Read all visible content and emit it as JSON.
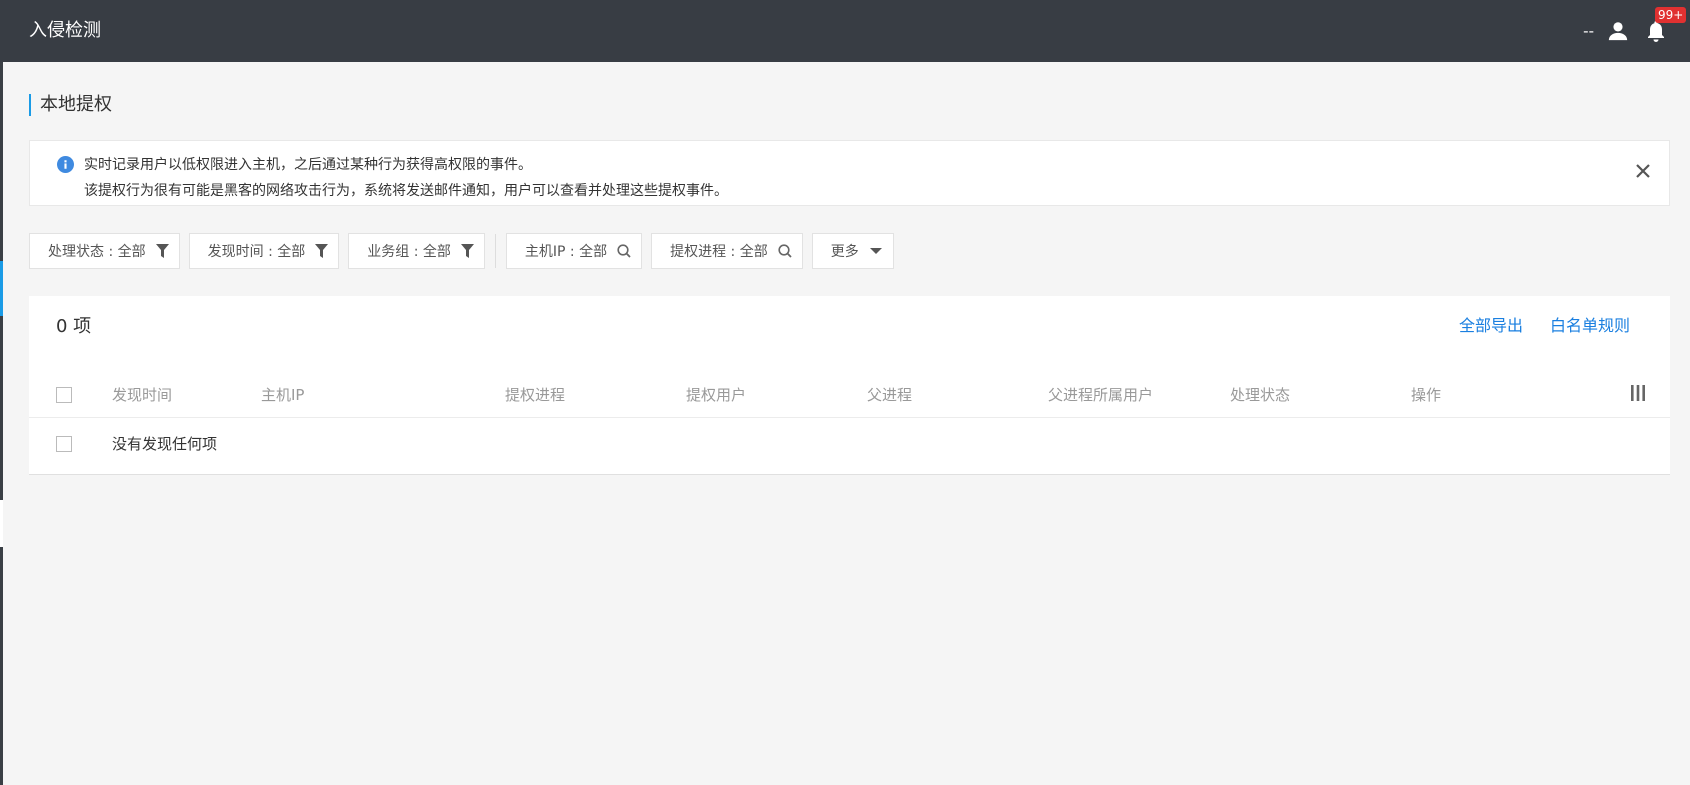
{
  "header": {
    "title": "入侵检测",
    "user_name": "--",
    "notification_badge": "99+"
  },
  "page": {
    "title": "本地提权"
  },
  "banner": {
    "line1": "实时记录用户以低权限进入主机，之后通过某种行为获得高权限的事件。",
    "line2": "该提权行为很有可能是黑客的网络攻击行为，系统将发送邮件通知，用户可以查看并处理这些提权事件。"
  },
  "filters": {
    "status": "处理状态 : 全部",
    "found_time": "发现时间 : 全部",
    "business_group": "业务组 : 全部",
    "host_ip": "主机IP : 全部",
    "process": "提权进程 : 全部",
    "more": "更多"
  },
  "table": {
    "count": "0 项",
    "export_label": "全部导出",
    "whitelist_label": "白名单规则",
    "columns": [
      "发现时间",
      "主机IP",
      "提权进程",
      "提权用户",
      "父进程",
      "父进程所属用户",
      "处理状态",
      "操作"
    ],
    "empty_text": "没有发现任何项"
  },
  "colors": {
    "header_bg": "#383d44",
    "accent": "#1a9be6",
    "link": "#1a7fe0",
    "badge": "#e03131"
  }
}
